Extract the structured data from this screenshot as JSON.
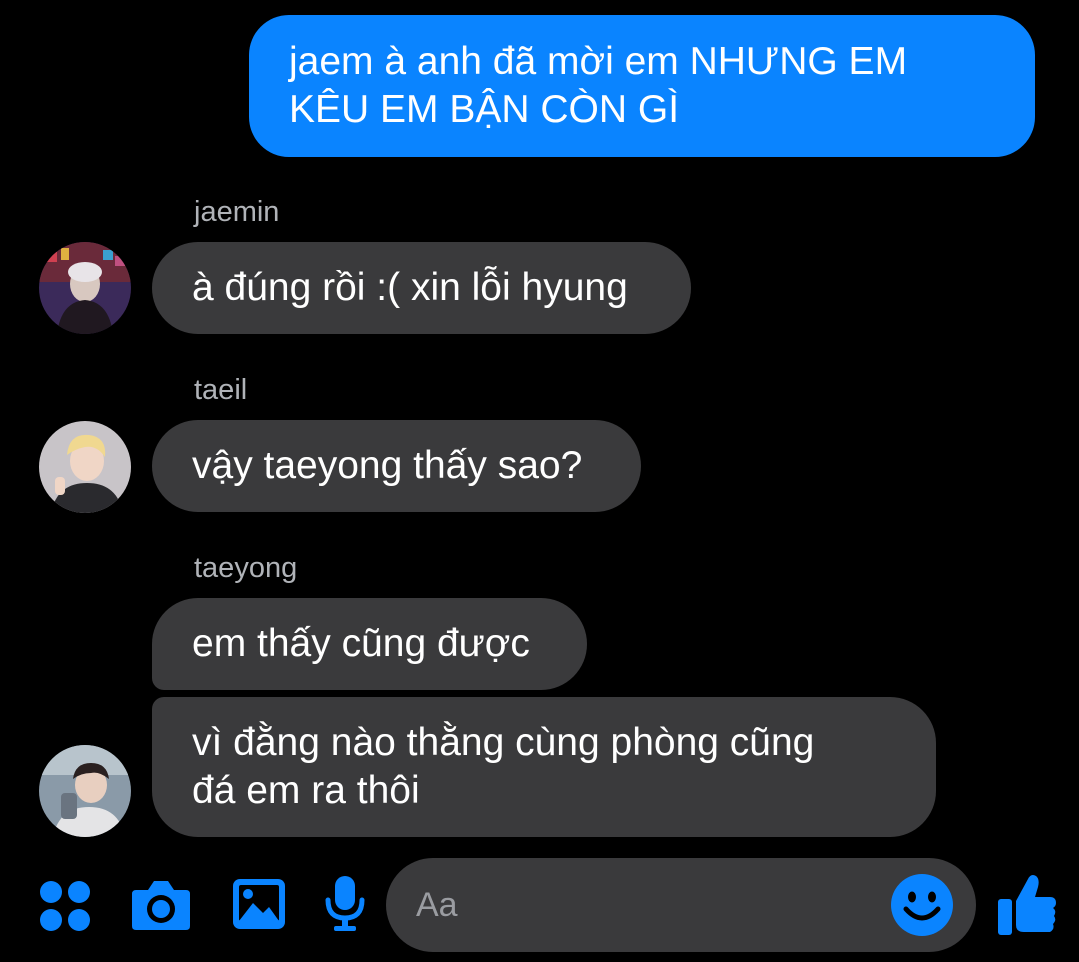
{
  "colors": {
    "accent": "#0a84ff",
    "background": "#000000",
    "incoming_bubble": "#3a3a3c",
    "sender_name": "#b0b3b8"
  },
  "messages": [
    {
      "direction": "outgoing",
      "text": "jaem à anh đã mời em NHƯNG EM\nKÊU EM BẬN CÒN GÌ"
    },
    {
      "direction": "incoming",
      "sender": "jaemin",
      "text": "à đúng rồi :( xin lỗi hyung"
    },
    {
      "direction": "incoming",
      "sender": "taeil",
      "text": "vậy taeyong thấy sao?"
    },
    {
      "direction": "incoming",
      "sender": "taeyong",
      "text": "em thấy cũng được"
    },
    {
      "direction": "incoming",
      "sender": "taeyong",
      "text": "vì đằng nào thằng cùng phòng cũng\nđá em ra thôi"
    }
  ],
  "composer": {
    "placeholder": "Aa",
    "icons": [
      "apps-icon",
      "camera-icon",
      "gallery-icon",
      "microphone-icon",
      "emoji-icon",
      "thumbs-up-icon"
    ]
  }
}
